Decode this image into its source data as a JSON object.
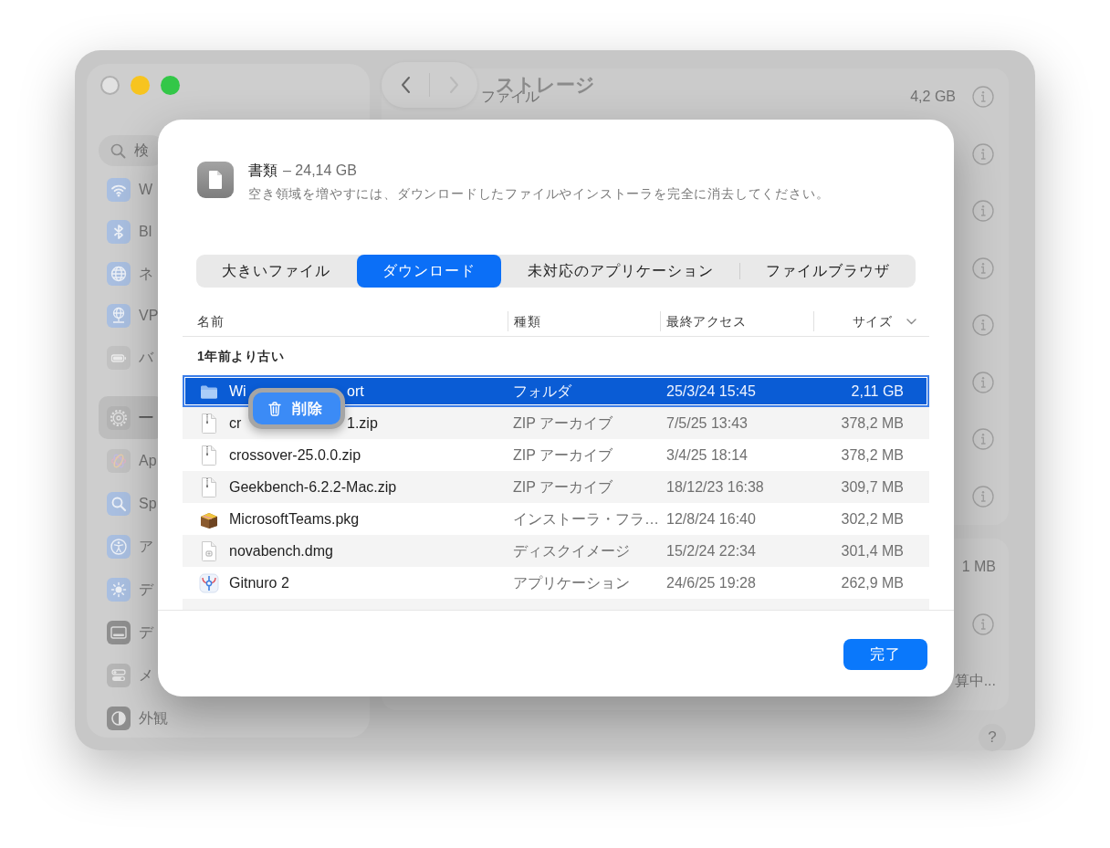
{
  "window": {
    "title": "ストレージ",
    "controls": [
      {
        "kind": "close",
        "disabled": true
      },
      {
        "kind": "minimize",
        "disabled": false
      },
      {
        "kind": "zoom",
        "disabled": false
      }
    ],
    "navigation": [
      {
        "kind": "back",
        "disabled": false
      },
      {
        "kind": "forward",
        "disabled": true
      }
    ],
    "help_button": "?"
  },
  "sidebar": {
    "search": {
      "placeholder": "検"
    },
    "groups": [
      {
        "items": [
          {
            "label": "W",
            "selected": false
          },
          {
            "label": "Bl",
            "selected": false
          },
          {
            "label": "ネ",
            "selected": false
          },
          {
            "label": "VP",
            "selected": false
          },
          {
            "label": "バ",
            "selected": false
          }
        ]
      },
      {
        "items": [
          {
            "label": "一",
            "selected": true
          },
          {
            "label": "Ap",
            "selected": false
          },
          {
            "label": "Sp",
            "selected": false
          },
          {
            "label": "ア",
            "selected": false
          },
          {
            "label": "デ",
            "selected": false
          },
          {
            "label": "デ",
            "selected": false
          },
          {
            "label": "メ",
            "selected": false
          },
          {
            "label": "外観",
            "selected": false
          }
        ]
      }
    ]
  },
  "storage_list": {
    "groups": [
      {
        "rows": [
          {
            "label": "ファイル",
            "size": "4,2 GB",
            "info": true
          },
          {
            "info": true
          },
          {
            "info": true
          },
          {
            "info": true
          },
          {
            "info": true
          },
          {
            "info": true
          },
          {
            "info": true
          },
          {
            "info": true
          }
        ]
      },
      {
        "rows": [
          {
            "size": "1 MB",
            "info": false
          },
          {
            "info": true
          },
          {
            "size": "算中...",
            "info": false
          }
        ]
      }
    ]
  },
  "dialog": {
    "category": {
      "name": "書類",
      "size": "– 24,14 GB",
      "description": "空き領域を増やすには、ダウンロードしたファイルやインストーラを完全に消去してください。"
    },
    "tabs": [
      {
        "label": "大きいファイル",
        "selected": false
      },
      {
        "label": "ダウンロード",
        "selected": true
      },
      {
        "label": "未対応のアプリケーション",
        "selected": false
      },
      {
        "label": "ファイルブラウザ",
        "selected": false
      }
    ],
    "table": {
      "columns": [
        {
          "label": "名前",
          "sorted": false
        },
        {
          "label": "種類",
          "sorted": false
        },
        {
          "label": "最終アクセス",
          "sorted": false
        },
        {
          "label": "サイズ",
          "sorted": true
        }
      ],
      "groups": [
        {
          "title": "1年前より古い",
          "rows": [
            {
              "kind": "folder",
              "name_parts": [
                "Wi",
                "ort"
              ],
              "type": "フォルダ",
              "accessed": "25/3/24 15:45",
              "size": "2,11 GB",
              "selected": true
            },
            {
              "kind": "zip",
              "name_parts": [
                "cr",
                "1.zip"
              ],
              "type": "ZIP アーカイブ",
              "accessed": "7/5/25 13:43",
              "size": "378,2 MB",
              "selected": false
            },
            {
              "kind": "zip",
              "name": "crossover-25.0.0.zip",
              "type": "ZIP アーカイブ",
              "accessed": "3/4/25 18:14",
              "size": "378,2 MB",
              "selected": false
            },
            {
              "kind": "zip",
              "name": "Geekbench-6.2.2-Mac.zip",
              "type": "ZIP アーカイブ",
              "accessed": "18/12/23 16:38",
              "size": "309,7 MB",
              "selected": false
            },
            {
              "kind": "package",
              "name": "MicrosoftTeams.pkg",
              "type": "インストーラ・フラ…",
              "accessed": "12/8/24 16:40",
              "size": "302,2 MB",
              "selected": false
            },
            {
              "kind": "disk_image",
              "name": "novabench.dmg",
              "type": "ディスクイメージ",
              "accessed": "15/2/24 22:34",
              "size": "301,4 MB",
              "selected": false
            },
            {
              "kind": "app",
              "name": "Gitnuro 2",
              "type": "アプリケーション",
              "accessed": "24/6/25 19:28",
              "size": "262,9 MB",
              "selected": false
            },
            {
              "selected": false
            }
          ]
        }
      ]
    },
    "context_button": {
      "label": "削除"
    },
    "done_button": "完了"
  }
}
